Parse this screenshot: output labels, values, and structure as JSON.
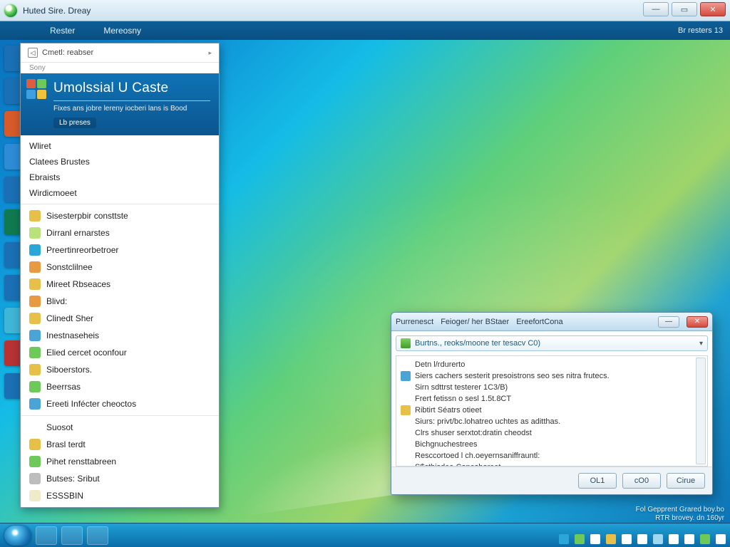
{
  "titlebar": {
    "title": "Huted Sire. Dreay"
  },
  "window_buttons": {
    "min": "—",
    "max": "▭",
    "close": "✕"
  },
  "menubar": {
    "items": [
      "Rester",
      "Mereosny"
    ],
    "clock": "Br resters 13"
  },
  "desktop_icon_colors": [
    "#1b6fb5",
    "#1b6fb5",
    "#d75b2a",
    "#2e8bd6",
    "#1b6fb5",
    "#0f7a4f",
    "#1b6fb5",
    "#1b6fb5",
    "#3fb6d6",
    "#b73232",
    "#1b6fb5"
  ],
  "panel": {
    "top_label": "Cmetl: reabser",
    "back_glyph": "◁",
    "sony": "Sony",
    "title": "Umolssial U Caste",
    "blurb": "Fixes ans jobre lereny iocberi lans is Bood",
    "pill": "Lb preses",
    "group1": [
      "Wliret",
      "Clatees Brustes",
      "Ebraists",
      "Wirdicmoeet"
    ],
    "group2": [
      {
        "ico": "#e7c04a",
        "txt": "Sisesterpbir consttste"
      },
      {
        "ico": "#b8e27a",
        "txt": "Dirranl ernarstes"
      },
      {
        "ico": "#2aa7d6",
        "txt": "Preertinreorbetroer"
      },
      {
        "ico": "#e79a3f",
        "txt": "Sonstclilnee"
      },
      {
        "ico": "#e7c04a",
        "txt": "Mireet Rbseaces"
      },
      {
        "ico": "#e79a3f",
        "txt": "Blivd:"
      },
      {
        "ico": "#e7c04a",
        "txt": "Clinedt Sher"
      },
      {
        "ico": "#4aa4d6",
        "txt": "Inestnaseheis"
      },
      {
        "ico": "#6fc95a",
        "txt": "Elied cercet oconfour"
      },
      {
        "ico": "#e7c04a",
        "txt": "Siboerstors."
      },
      {
        "ico": "#6fc95a",
        "txt": "Beerrsas"
      },
      {
        "ico": "#4aa4d6",
        "txt": "Ereeti Infécter cheoctos"
      }
    ],
    "group3": [
      {
        "ico": "",
        "txt": "Suosot"
      },
      {
        "ico": "#e7c04a",
        "txt": "Brasl terdt"
      },
      {
        "ico": "#6fc95a",
        "txt": "Pihet rensttabreen"
      },
      {
        "ico": "#bdbdbd",
        "txt": "Butses: Sribut"
      },
      {
        "ico": "#efebc8",
        "txt": "ESSSBIN"
      }
    ]
  },
  "dialog": {
    "tab1": "Purrenesct",
    "tab2": "Feioger/ her BStaer",
    "tab3": "EreefortCona",
    "path": "Burtns., reoks/moone ter tesacv C0)",
    "lines": [
      {
        "ico": "",
        "txt": "Detn l/rdurerto"
      },
      {
        "ico": "#4aa4d6",
        "txt": "Siers cachers sesterit presoistrons seo ses nitra frutecs."
      },
      {
        "ico": "",
        "txt": "Sirn sdttrst testerer 1C3/B)"
      },
      {
        "ico": "",
        "txt": "Frert fetissn o sesl 1.5t.8CT"
      },
      {
        "ico": "#e7c04a",
        "txt": "Ribtirt Séatrs otieet"
      },
      {
        "ico": "",
        "txt": "Siurs: privt/bc.lohatreo uchtes as aditthas."
      },
      {
        "ico": "",
        "txt": "Clrs shuser serxtot:dratin cheodst"
      },
      {
        "ico": "",
        "txt": "Bichgnuchestrees"
      },
      {
        "ico": "",
        "txt": "Resccortoed l ch.oeyernsaniffrauntl:"
      },
      {
        "ico": "",
        "txt": "S$cthisdee Coneshoreet"
      }
    ],
    "buttons": [
      "OL1",
      "cO0",
      "Cirue"
    ]
  },
  "footnote": {
    "l1": "Fol Gepprent Grared boy.bo",
    "l2": "RTR brovey. dn 160yr"
  },
  "tray_colors": [
    "#2aa7d6",
    "#6fc95a",
    "#ffffff",
    "#e7c04a",
    "#ffffff",
    "#ffffff",
    "#9fd6f0",
    "#ffffff",
    "#ffffff",
    "#6fc95a",
    "#ffffff"
  ]
}
